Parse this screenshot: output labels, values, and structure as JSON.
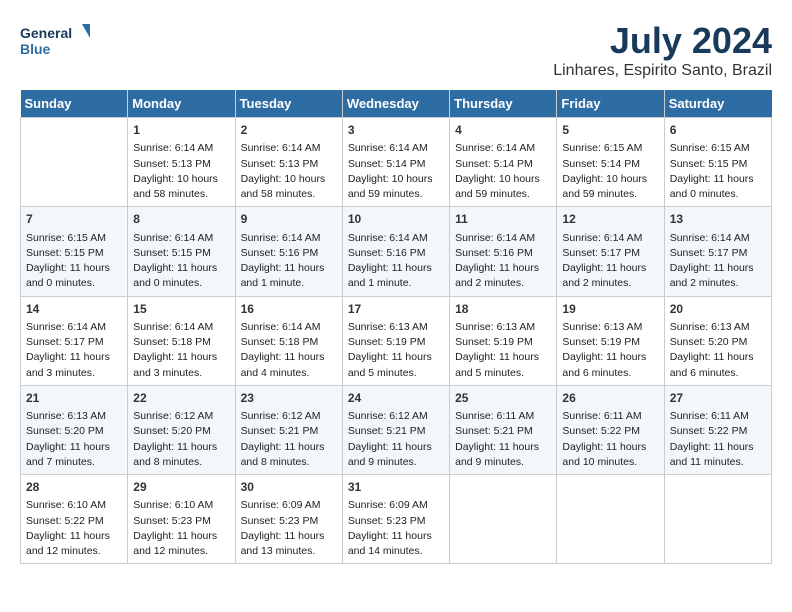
{
  "header": {
    "logo_line1": "General",
    "logo_line2": "Blue",
    "month_title": "July 2024",
    "location": "Linhares, Espirito Santo, Brazil"
  },
  "weekdays": [
    "Sunday",
    "Monday",
    "Tuesday",
    "Wednesday",
    "Thursday",
    "Friday",
    "Saturday"
  ],
  "weeks": [
    [
      {
        "day": "",
        "info": ""
      },
      {
        "day": "1",
        "info": "Sunrise: 6:14 AM\nSunset: 5:13 PM\nDaylight: 10 hours\nand 58 minutes."
      },
      {
        "day": "2",
        "info": "Sunrise: 6:14 AM\nSunset: 5:13 PM\nDaylight: 10 hours\nand 58 minutes."
      },
      {
        "day": "3",
        "info": "Sunrise: 6:14 AM\nSunset: 5:14 PM\nDaylight: 10 hours\nand 59 minutes."
      },
      {
        "day": "4",
        "info": "Sunrise: 6:14 AM\nSunset: 5:14 PM\nDaylight: 10 hours\nand 59 minutes."
      },
      {
        "day": "5",
        "info": "Sunrise: 6:15 AM\nSunset: 5:14 PM\nDaylight: 10 hours\nand 59 minutes."
      },
      {
        "day": "6",
        "info": "Sunrise: 6:15 AM\nSunset: 5:15 PM\nDaylight: 11 hours\nand 0 minutes."
      }
    ],
    [
      {
        "day": "7",
        "info": "Sunrise: 6:15 AM\nSunset: 5:15 PM\nDaylight: 11 hours\nand 0 minutes."
      },
      {
        "day": "8",
        "info": "Sunrise: 6:14 AM\nSunset: 5:15 PM\nDaylight: 11 hours\nand 0 minutes."
      },
      {
        "day": "9",
        "info": "Sunrise: 6:14 AM\nSunset: 5:16 PM\nDaylight: 11 hours\nand 1 minute."
      },
      {
        "day": "10",
        "info": "Sunrise: 6:14 AM\nSunset: 5:16 PM\nDaylight: 11 hours\nand 1 minute."
      },
      {
        "day": "11",
        "info": "Sunrise: 6:14 AM\nSunset: 5:16 PM\nDaylight: 11 hours\nand 2 minutes."
      },
      {
        "day": "12",
        "info": "Sunrise: 6:14 AM\nSunset: 5:17 PM\nDaylight: 11 hours\nand 2 minutes."
      },
      {
        "day": "13",
        "info": "Sunrise: 6:14 AM\nSunset: 5:17 PM\nDaylight: 11 hours\nand 2 minutes."
      }
    ],
    [
      {
        "day": "14",
        "info": "Sunrise: 6:14 AM\nSunset: 5:17 PM\nDaylight: 11 hours\nand 3 minutes."
      },
      {
        "day": "15",
        "info": "Sunrise: 6:14 AM\nSunset: 5:18 PM\nDaylight: 11 hours\nand 3 minutes."
      },
      {
        "day": "16",
        "info": "Sunrise: 6:14 AM\nSunset: 5:18 PM\nDaylight: 11 hours\nand 4 minutes."
      },
      {
        "day": "17",
        "info": "Sunrise: 6:13 AM\nSunset: 5:19 PM\nDaylight: 11 hours\nand 5 minutes."
      },
      {
        "day": "18",
        "info": "Sunrise: 6:13 AM\nSunset: 5:19 PM\nDaylight: 11 hours\nand 5 minutes."
      },
      {
        "day": "19",
        "info": "Sunrise: 6:13 AM\nSunset: 5:19 PM\nDaylight: 11 hours\nand 6 minutes."
      },
      {
        "day": "20",
        "info": "Sunrise: 6:13 AM\nSunset: 5:20 PM\nDaylight: 11 hours\nand 6 minutes."
      }
    ],
    [
      {
        "day": "21",
        "info": "Sunrise: 6:13 AM\nSunset: 5:20 PM\nDaylight: 11 hours\nand 7 minutes."
      },
      {
        "day": "22",
        "info": "Sunrise: 6:12 AM\nSunset: 5:20 PM\nDaylight: 11 hours\nand 8 minutes."
      },
      {
        "day": "23",
        "info": "Sunrise: 6:12 AM\nSunset: 5:21 PM\nDaylight: 11 hours\nand 8 minutes."
      },
      {
        "day": "24",
        "info": "Sunrise: 6:12 AM\nSunset: 5:21 PM\nDaylight: 11 hours\nand 9 minutes."
      },
      {
        "day": "25",
        "info": "Sunrise: 6:11 AM\nSunset: 5:21 PM\nDaylight: 11 hours\nand 9 minutes."
      },
      {
        "day": "26",
        "info": "Sunrise: 6:11 AM\nSunset: 5:22 PM\nDaylight: 11 hours\nand 10 minutes."
      },
      {
        "day": "27",
        "info": "Sunrise: 6:11 AM\nSunset: 5:22 PM\nDaylight: 11 hours\nand 11 minutes."
      }
    ],
    [
      {
        "day": "28",
        "info": "Sunrise: 6:10 AM\nSunset: 5:22 PM\nDaylight: 11 hours\nand 12 minutes."
      },
      {
        "day": "29",
        "info": "Sunrise: 6:10 AM\nSunset: 5:23 PM\nDaylight: 11 hours\nand 12 minutes."
      },
      {
        "day": "30",
        "info": "Sunrise: 6:09 AM\nSunset: 5:23 PM\nDaylight: 11 hours\nand 13 minutes."
      },
      {
        "day": "31",
        "info": "Sunrise: 6:09 AM\nSunset: 5:23 PM\nDaylight: 11 hours\nand 14 minutes."
      },
      {
        "day": "",
        "info": ""
      },
      {
        "day": "",
        "info": ""
      },
      {
        "day": "",
        "info": ""
      }
    ]
  ]
}
